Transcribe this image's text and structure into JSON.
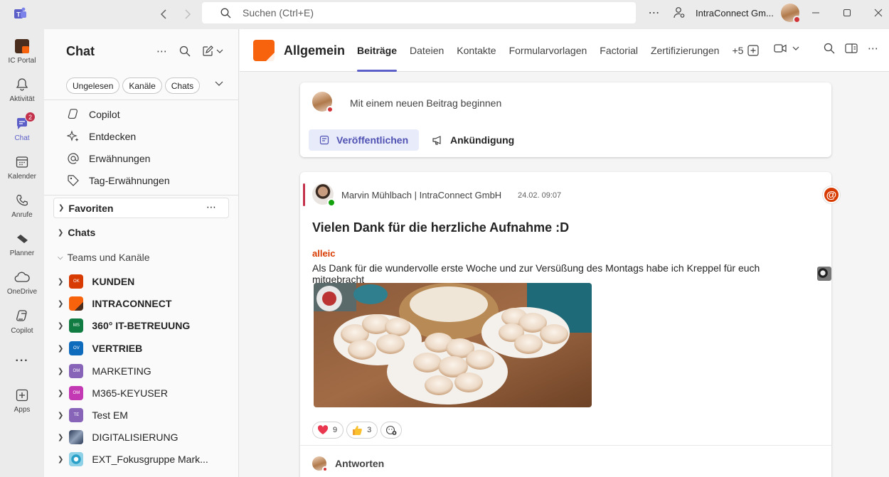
{
  "titlebar": {
    "search_placeholder": "Suchen (Ctrl+E)",
    "org_name": "IntraConnect Gm...",
    "more": "⋯"
  },
  "rail": [
    {
      "label": "IC Portal",
      "icon": "ic-portal-icon"
    },
    {
      "label": "Aktivität",
      "icon": "bell-icon"
    },
    {
      "label": "Chat",
      "icon": "chat-icon",
      "badge": "2",
      "active": true
    },
    {
      "label": "Kalender",
      "icon": "calendar-icon"
    },
    {
      "label": "Anrufe",
      "icon": "phone-icon"
    },
    {
      "label": "Planner",
      "icon": "planner-icon"
    },
    {
      "label": "OneDrive",
      "icon": "cloud-icon"
    },
    {
      "label": "Copilot",
      "icon": "copilot-icon"
    },
    {
      "label": "Apps",
      "icon": "add-apps-icon"
    }
  ],
  "rail_more": "···",
  "chatpane": {
    "title": "Chat",
    "more": "⋯",
    "filters": [
      "Ungelesen",
      "Kanäle",
      "Chats"
    ],
    "nav": [
      {
        "label": "Copilot",
        "icon": "copilot-icon"
      },
      {
        "label": "Entdecken",
        "icon": "sparkle-icon"
      },
      {
        "label": "Erwähnungen",
        "icon": "at-icon"
      },
      {
        "label": "Tag-Erwähnungen",
        "icon": "tag-icon"
      }
    ],
    "favorites": "Favoriten",
    "favorites_more": "⋯",
    "chats": "Chats",
    "teams_header": "Teams und Kanäle",
    "teams": [
      {
        "name": "KUNDEN",
        "initials": "OK",
        "color": "#d83b01",
        "bold": true
      },
      {
        "name": "INTRACONNECT",
        "initials": "",
        "color": "#f7630c",
        "bold": true
      },
      {
        "name": "360° IT-BETREUUNG",
        "initials": "MS",
        "color": "#107c41",
        "bold": true
      },
      {
        "name": "VERTRIEB",
        "initials": "OV",
        "color": "#0f6cbd",
        "bold": true
      },
      {
        "name": "MARKETING",
        "initials": "OM",
        "color": "#8764b8",
        "bold": false
      },
      {
        "name": "M365-KEYUSER",
        "initials": "OM",
        "color": "#c239b3",
        "bold": false
      },
      {
        "name": "Test EM",
        "initials": "TE",
        "color": "#8764b8",
        "bold": false
      },
      {
        "name": "DIGITALISIERUNG",
        "initials": "",
        "color": "#4a5a7a",
        "bold": false
      },
      {
        "name": "EXT_Fokusgruppe Mark...",
        "initials": "",
        "color": "#2aa0c8",
        "bold": false
      }
    ]
  },
  "channel": {
    "name": "Allgemein",
    "tabs": [
      "Beiträge",
      "Dateien",
      "Kontakte",
      "Formularvorlagen",
      "Factorial",
      "Zertifizierungen"
    ],
    "active_tab": "Beiträge",
    "more_tabs": "+5"
  },
  "compose": {
    "placeholder": "Mit einem neuen Beitrag beginnen",
    "publish": "Veröffentlichen",
    "announce": "Ankündigung"
  },
  "post": {
    "author": "Marvin Mühlbach | IntraConnect GmbH",
    "time": "24.02. 09:07",
    "subject": "Vielen Dank für die herzliche Aufnahme :D",
    "mention": "alleic",
    "body": "Als Dank für die wundervolle erste Woche und zur Versüßung des Montags habe ich Kreppel für euch mitgebracht",
    "reactions": [
      {
        "emoji": "heart-icon",
        "count": "9"
      },
      {
        "emoji": "thumbs-up-icon",
        "count": "3"
      }
    ],
    "reply": "Antworten"
  },
  "colors": {
    "accent": "#5b5fc7",
    "mention": "#d83b01",
    "dnd": "#d13438",
    "available": "#13a10e"
  }
}
